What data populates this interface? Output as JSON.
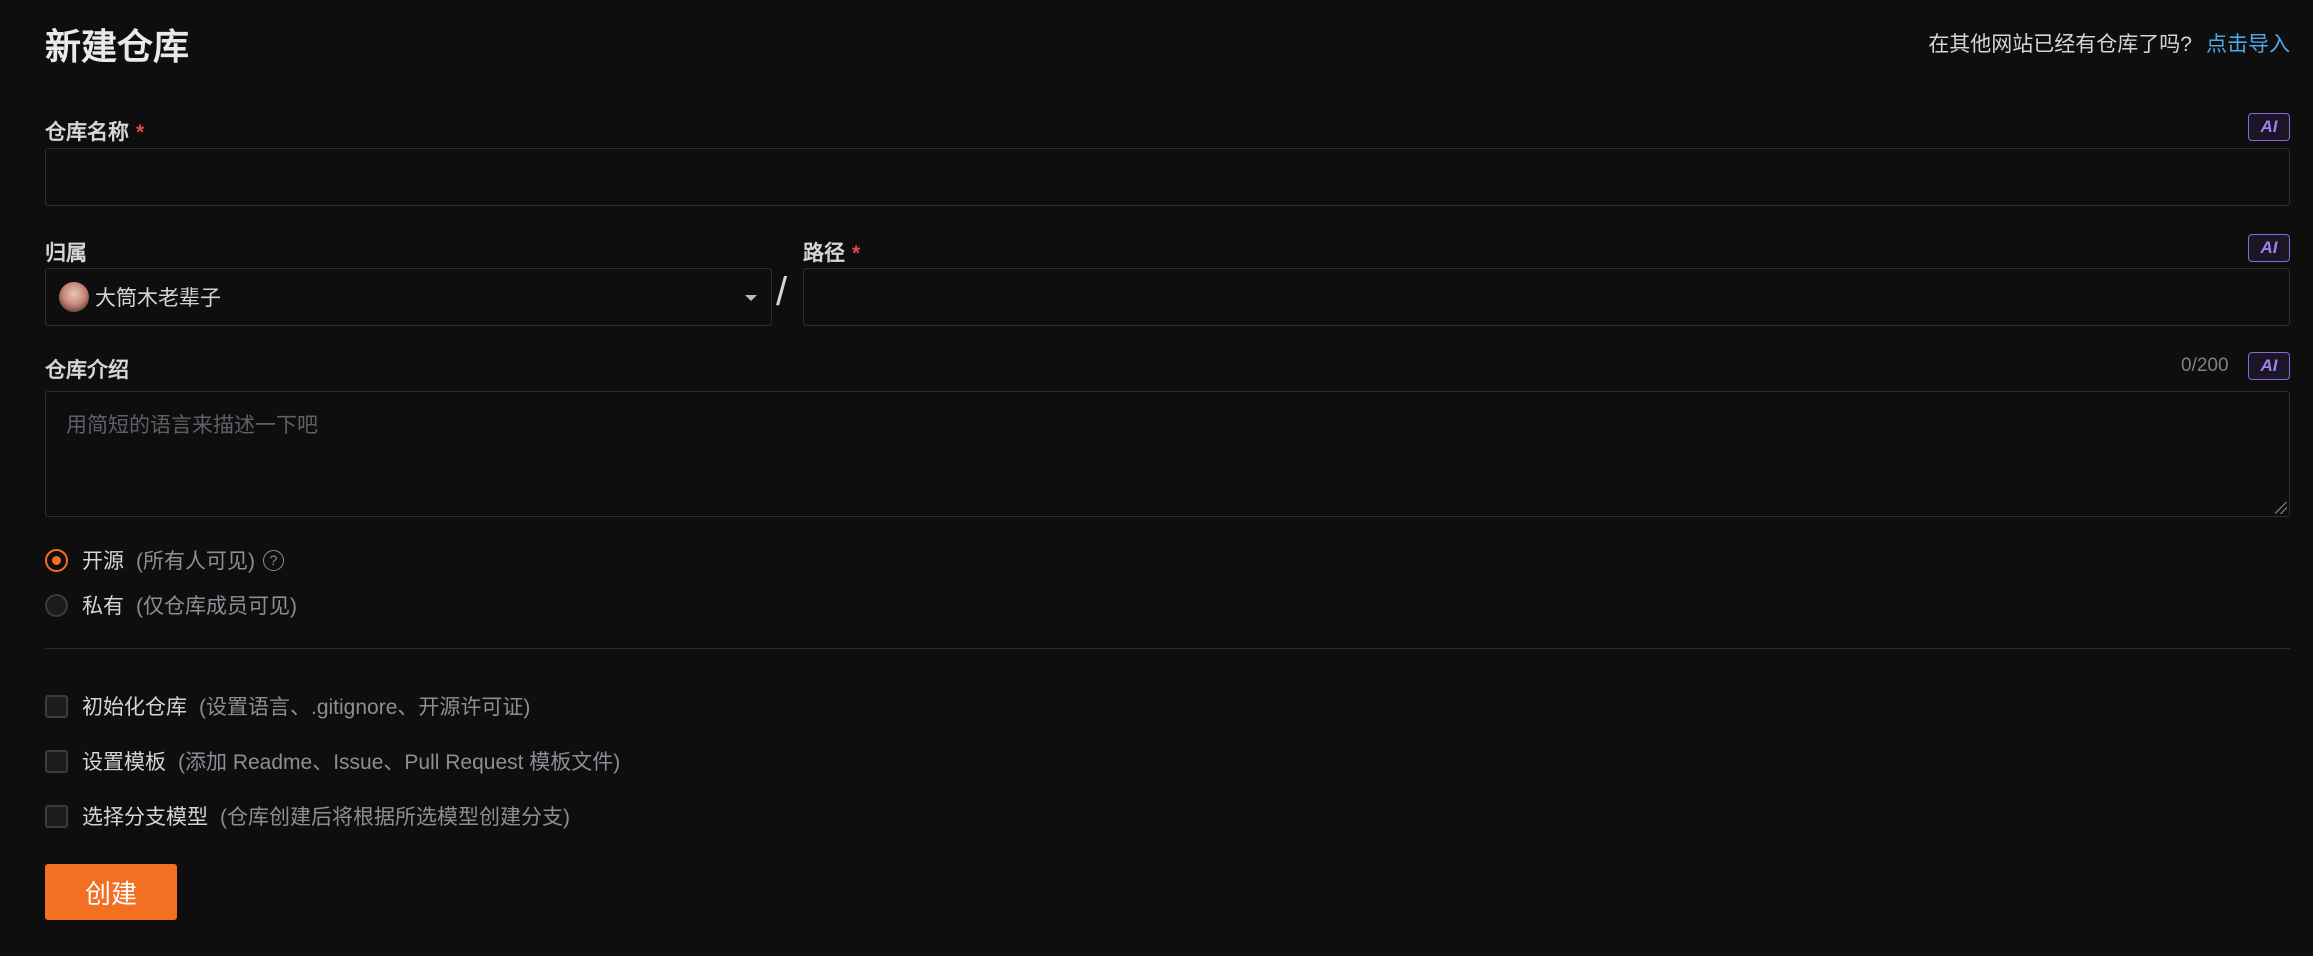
{
  "header": {
    "title": "新建仓库",
    "import_hint": "在其他网站已经有仓库了吗?",
    "import_link": "点击导入"
  },
  "repo_name": {
    "label": "仓库名称",
    "required_mark": "*",
    "value": "",
    "ai_label": "AI"
  },
  "owner": {
    "label": "归属",
    "selected": "大筒木老辈子"
  },
  "path": {
    "label": "路径",
    "required_mark": "*",
    "separator": "/",
    "value": "",
    "ai_label": "AI"
  },
  "description": {
    "label": "仓库介绍",
    "counter": "0/200",
    "placeholder": "用简短的语言来描述一下吧",
    "ai_label": "AI"
  },
  "visibility": {
    "selected": "public",
    "options": [
      {
        "label": "开源",
        "desc": "(所有人可见)"
      },
      {
        "label": "私有",
        "desc": "(仅仓库成员可见)"
      }
    ]
  },
  "options": [
    {
      "label": "初始化仓库",
      "desc": "(设置语言、.gitignore、开源许可证)",
      "checked": false
    },
    {
      "label": "设置模板",
      "desc": "(添加 Readme、Issue、Pull Request 模板文件)",
      "checked": false
    },
    {
      "label": "选择分支模型",
      "desc": "(仓库创建后将根据所选模型创建分支)",
      "checked": false
    }
  ],
  "submit": {
    "label": "创建"
  },
  "colors": {
    "accent": "#f36f21",
    "link": "#4ea9e8",
    "required": "#e5484d",
    "ai_badge": "#9d82ef",
    "background": "#0e0e0f"
  }
}
